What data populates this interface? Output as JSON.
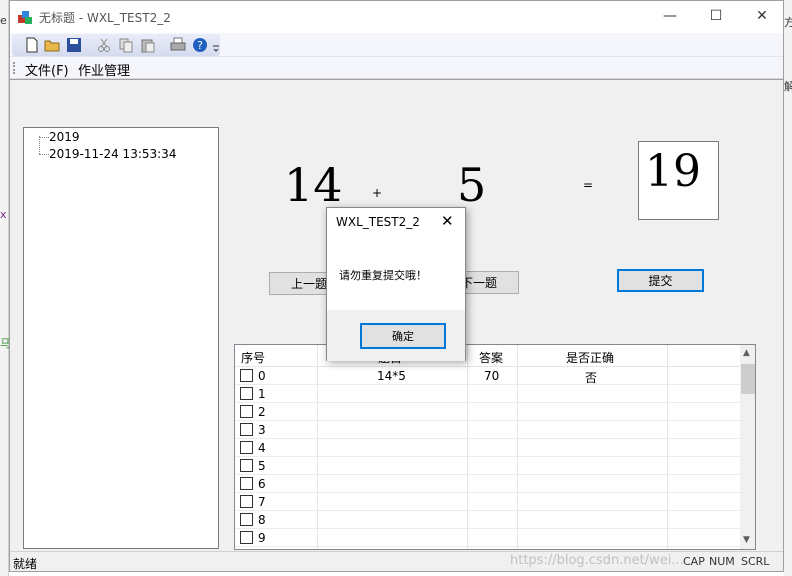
{
  "window": {
    "title": "无标题 - WXL_TEST2_2",
    "controls": {
      "minimize": "—",
      "maximize": "☐",
      "close": "✕"
    }
  },
  "left_edge": {
    "glyph1": "e",
    "glyph2": "x",
    "glyph3": "马"
  },
  "right_edge": {
    "glyph1": "方",
    "glyph2": "解"
  },
  "toolbar": {
    "icons": [
      "new-file-icon",
      "open-folder-icon",
      "save-icon",
      "cut-icon",
      "copy-icon",
      "paste-icon",
      "print-icon",
      "help-icon"
    ]
  },
  "menu": {
    "file": "文件(F)",
    "homework": "作业管理"
  },
  "tree": {
    "items": [
      "2019",
      "2019-11-24 13:53:34"
    ]
  },
  "question": {
    "operand1": "14",
    "operator": "+",
    "operand2": "5",
    "equals": "=",
    "answer": "19"
  },
  "buttons": {
    "prev": "上一题",
    "next": "下一题",
    "submit": "提交"
  },
  "grid": {
    "headers": [
      "序号",
      "题目",
      "答案",
      "是否正确"
    ],
    "rows": [
      {
        "index": "0",
        "question": "14*5",
        "answer": "70",
        "correct": "否"
      },
      {
        "index": "1",
        "question": "",
        "answer": "",
        "correct": ""
      },
      {
        "index": "2",
        "question": "",
        "answer": "",
        "correct": ""
      },
      {
        "index": "3",
        "question": "",
        "answer": "",
        "correct": ""
      },
      {
        "index": "4",
        "question": "",
        "answer": "",
        "correct": ""
      },
      {
        "index": "5",
        "question": "",
        "answer": "",
        "correct": ""
      },
      {
        "index": "6",
        "question": "",
        "answer": "",
        "correct": ""
      },
      {
        "index": "7",
        "question": "",
        "answer": "",
        "correct": ""
      },
      {
        "index": "8",
        "question": "",
        "answer": "",
        "correct": ""
      },
      {
        "index": "9",
        "question": "",
        "answer": "",
        "correct": ""
      }
    ]
  },
  "status": {
    "text": "就绪",
    "cap": "CAP",
    "num": "NUM",
    "scrl": "SCRL",
    "watermark": "https://blog.csdn.net/wei..."
  },
  "dialog": {
    "title": "WXL_TEST2_2",
    "close": "✕",
    "message": "请勿重复提交哦！",
    "ok": "确定"
  }
}
